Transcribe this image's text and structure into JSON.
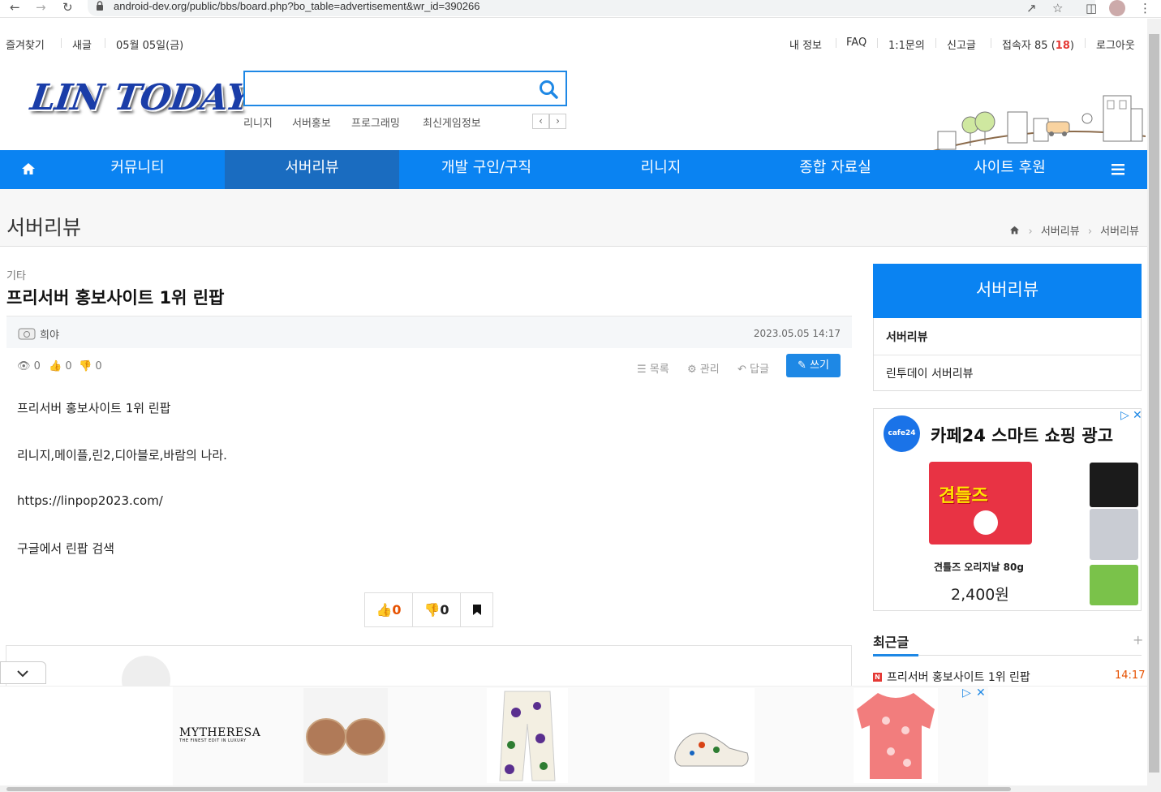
{
  "browser": {
    "url": "android-dev.org/public/bbs/board.php?bo_table=advertisement&wr_id=390266"
  },
  "topbar": {
    "left": [
      "즐겨찾기",
      "새글",
      "05월 05일(금)"
    ],
    "right": [
      "내 정보",
      "FAQ",
      "1:1문의",
      "신고글",
      "접속자 85",
      "18",
      "로그아웃"
    ]
  },
  "logo": "LIN TODAY",
  "search": {
    "placeholder": "",
    "keywords": [
      "리니지",
      "서버홍보",
      "프로그래밍",
      "최신게임정보"
    ]
  },
  "nav": {
    "items": [
      "커뮤니티",
      "서버리뷰",
      "개발 구인/구직",
      "리니지",
      "종합 자료실",
      "사이트 후원"
    ],
    "active": "서버리뷰"
  },
  "page": {
    "title": "서버리뷰",
    "breadcrumb": [
      "서버리뷰",
      "서버리뷰"
    ]
  },
  "post": {
    "category": "기타",
    "subject": "프리서버 홍보사이트 1위 린팝",
    "author": "희야",
    "date": "2023.05.05 14:17",
    "views": "0",
    "likes": "0",
    "dislikes": "0",
    "actions": {
      "list": "목록",
      "manage": "관리",
      "reply": "답글",
      "write": "쓰기"
    },
    "body": [
      "프리서버 홍보사이트 1위 린팝",
      "리니지,메이플,린2,디아블로,바람의 나라.",
      "https://linpop2023.com/",
      "구글에서 린팝 검색"
    ],
    "vote_like": "0",
    "vote_dislike": "0"
  },
  "sidebar": {
    "title": "서버리뷰",
    "items": [
      "서버리뷰",
      "린투데이 서버리뷰"
    ],
    "ad": {
      "logo": "cafe24",
      "title": "카페24 스마트 쇼핑 광고",
      "product_label": "견들즈",
      "product_name": "견틀즈 오리지날 80g",
      "price": "2,400원"
    },
    "recent": {
      "heading": "최근글",
      "badge": "N",
      "title": "프리서버 홍보사이트 1위 린팝",
      "time": "14:17"
    }
  },
  "bottom_ad": {
    "brand": "MYTHERESA",
    "tagline": "THE FINEST EDIT IN LUXURY"
  },
  "colors": {
    "nav_bg": "#0a83f2",
    "nav_active": "#1a6cc0",
    "accent": "#1e88e5",
    "highlight": "#e53935"
  }
}
